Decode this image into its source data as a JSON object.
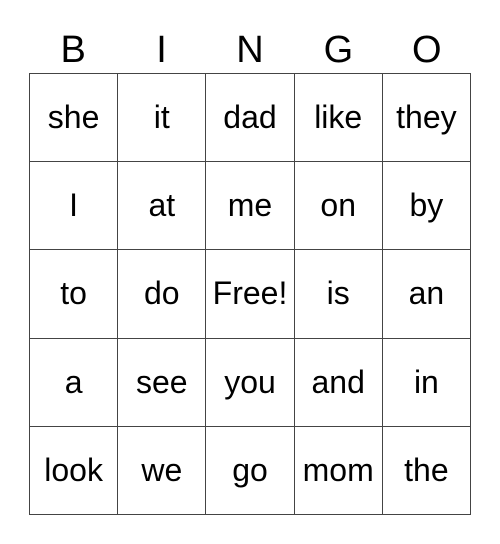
{
  "header": [
    "B",
    "I",
    "N",
    "G",
    "O"
  ],
  "cells": [
    [
      "she",
      "it",
      "dad",
      "like",
      "they"
    ],
    [
      "I",
      "at",
      "me",
      "on",
      "by"
    ],
    [
      "to",
      "do",
      "Free!",
      "is",
      "an"
    ],
    [
      "a",
      "see",
      "you",
      "and",
      "in"
    ],
    [
      "look",
      "we",
      "go",
      "mom",
      "the"
    ]
  ]
}
